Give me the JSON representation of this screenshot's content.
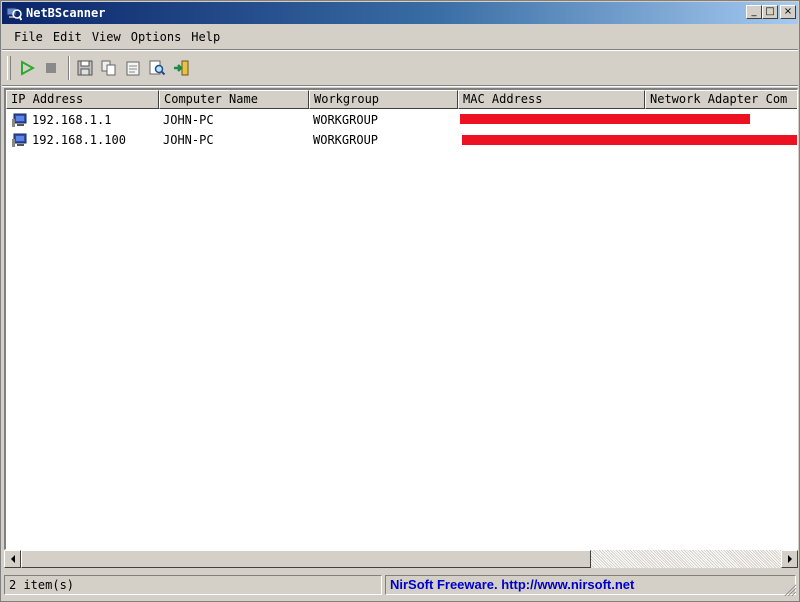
{
  "window": {
    "title": "NetBScanner",
    "icon": "network-scanner-icon"
  },
  "menu": [
    "File",
    "Edit",
    "View",
    "Options",
    "Help"
  ],
  "toolbar": {
    "buttons": [
      "start-scan-icon",
      "stop-scan-icon",
      "save-icon",
      "copy-icon",
      "properties-icon",
      "find-icon",
      "exit-icon"
    ]
  },
  "columns": [
    "IP Address",
    "Computer Name",
    "Workgroup",
    "MAC Address",
    "Network Adapter Com"
  ],
  "rows": [
    {
      "ip": "192.168.1.1",
      "computer": "JOHN-PC",
      "workgroup": "WORKGROUP",
      "mac": "",
      "adapter": ""
    },
    {
      "ip": "192.168.1.100",
      "computer": "JOHN-PC",
      "workgroup": "WORKGROUP",
      "mac": "",
      "adapter": ""
    }
  ],
  "status": {
    "count": "2 item(s)",
    "link": "NirSoft Freeware.  http://www.nirsoft.net"
  },
  "colors": {
    "title_start": "#0a246a",
    "redaction": "#ee1122",
    "link": "#0000cc",
    "play": "#2fa82f"
  }
}
